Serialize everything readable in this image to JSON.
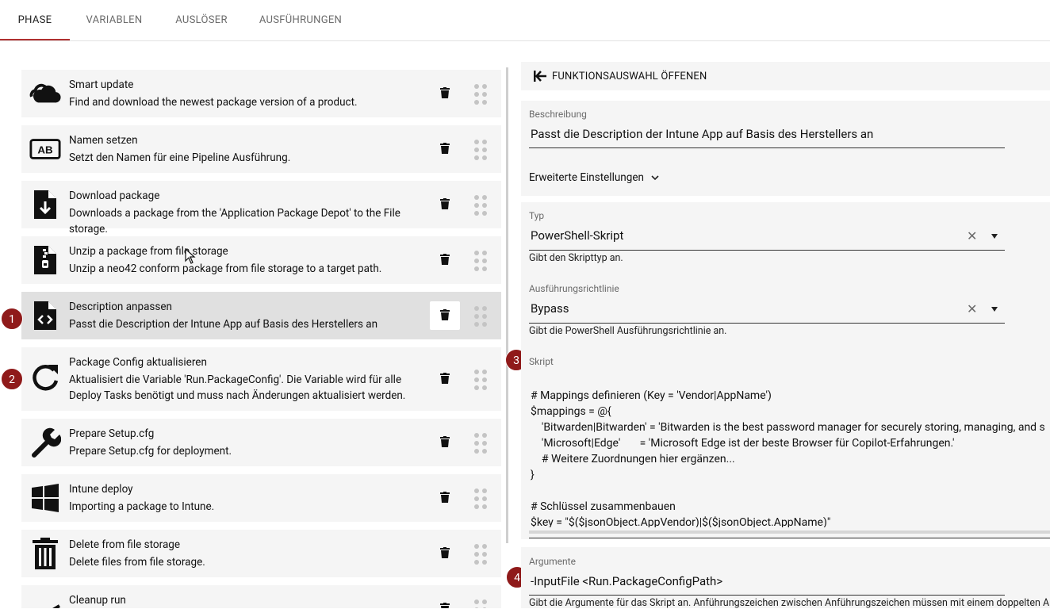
{
  "tabs": [
    "PHASE",
    "VARIABLEN",
    "AUSLÖSER",
    "AUSFÜHRUNGEN"
  ],
  "steps": [
    {
      "title": "Smart update",
      "desc": "Find and download the newest package version of a product.",
      "icon": "cloud-icon"
    },
    {
      "title": "Namen setzen",
      "desc": "Setzt den Namen für eine Pipeline Ausführung.",
      "icon": "ab-label-icon"
    },
    {
      "title": "Download package",
      "desc": "Downloads a package from the 'Application Package Depot' to the File storage.",
      "icon": "file-download-icon"
    },
    {
      "title": "Unzip a package from file storage",
      "desc": "Unzip a neo42 conform package from file storage to a target path.",
      "icon": "file-zip-icon"
    },
    {
      "title": "Description anpassen",
      "desc": "Passt die Description der Intune App auf Basis des Herstellers an",
      "icon": "file-code-icon"
    },
    {
      "title": "Package Config aktualisieren",
      "desc": "Aktualisiert die Variable 'Run.PackageConfig'. Die Variable wird für alle Deploy Tasks benötigt und muss nach Änderungen aktualisiert werden.",
      "icon": "refresh-icon"
    },
    {
      "title": "Prepare Setup.cfg",
      "desc": "Prepare Setup.cfg for deployment.",
      "icon": "wrench-icon"
    },
    {
      "title": "Intune deploy",
      "desc": "Importing a package to Intune.",
      "icon": "windows-icon"
    },
    {
      "title": "Delete from file storage",
      "desc": "Delete files from file storage.",
      "icon": "trash-can-icon"
    },
    {
      "title": "Cleanup run",
      "desc": "",
      "icon": "broom-icon"
    }
  ],
  "badges": [
    "1",
    "2",
    "3",
    "4"
  ],
  "panel": {
    "open_functions": "FUNKTIONSAUSWAHL ÖFFENEN",
    "description_label": "Beschreibung",
    "description_value": "Passt die Description der Intune App auf Basis des Herstellers an",
    "advanced": "Erweiterte Einstellungen",
    "type_label": "Typ",
    "type_value": "PowerShell-Skript",
    "type_hint": "Gibt den Skripttyp an.",
    "policy_label": "Ausführungsrichtlinie",
    "policy_value": "Bypass",
    "policy_hint": "Gibt die PowerShell Ausführungsrichtlinie an.",
    "script_label": "Skript",
    "script_lines": [
      "",
      "# Mappings definieren (Key = 'Vendor|AppName')",
      "$mappings = @{",
      "    'Bitwarden|Bitwarden' = 'Bitwarden is the best password manager for securely storing, managing, and s",
      "    'Microsoft|Edge'       = 'Microsoft Edge ist der beste Browser für Copilot-Erfahrungen.'",
      "    # Weitere Zuordnungen hier ergänzen...",
      "}",
      "",
      "# Schlüssel zusammenbauen",
      "$key = \"$($jsonObject.AppVendor)|$($jsonObject.AppName)\""
    ],
    "args_label": "Argumente",
    "args_value": "-InputFile <Run.PackageConfigPath>",
    "args_hint": "Gibt die Argumente für das Skript an. Anführungszeichen zwischen Anführungszeichen müssen mit einem doppelten An"
  },
  "colors": {
    "accent": "#b03030",
    "badge": "#8f1a1a",
    "item_bg": "#f5f5f5",
    "selected_bg": "#e0e0e0"
  }
}
